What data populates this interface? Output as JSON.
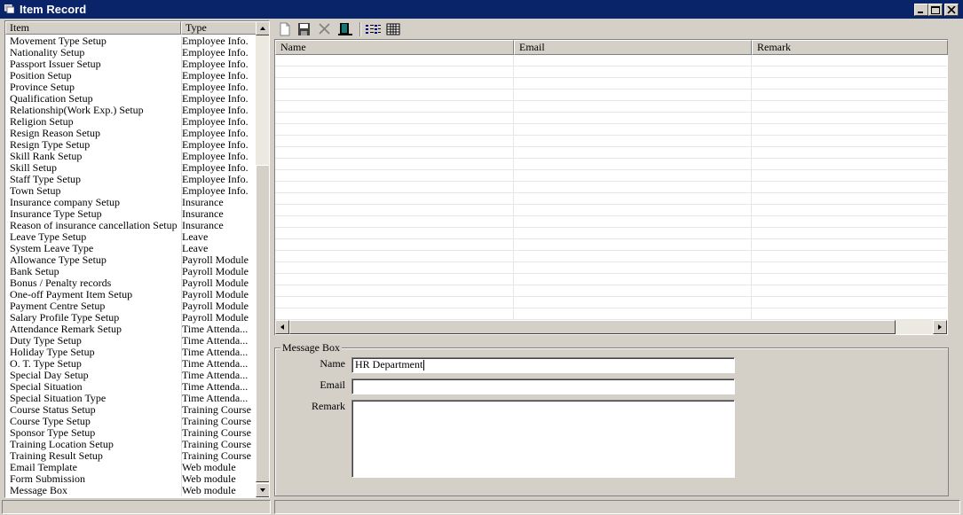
{
  "window": {
    "title": "Item Record"
  },
  "item_list": {
    "headers": {
      "item": "Item",
      "type": "Type"
    },
    "rows": [
      {
        "item": "Movement Type Setup",
        "type": "Employee Info."
      },
      {
        "item": "Nationality Setup",
        "type": "Employee Info."
      },
      {
        "item": "Passport Issuer Setup",
        "type": "Employee Info."
      },
      {
        "item": "Position Setup",
        "type": "Employee Info."
      },
      {
        "item": "Province Setup",
        "type": "Employee Info."
      },
      {
        "item": "Qualification Setup",
        "type": "Employee Info."
      },
      {
        "item": "Relationship(Work Exp.) Setup",
        "type": "Employee Info."
      },
      {
        "item": "Religion Setup",
        "type": "Employee Info."
      },
      {
        "item": "Resign Reason Setup",
        "type": "Employee Info."
      },
      {
        "item": "Resign Type Setup",
        "type": "Employee Info."
      },
      {
        "item": "Skill Rank Setup",
        "type": "Employee Info."
      },
      {
        "item": "Skill Setup",
        "type": "Employee Info."
      },
      {
        "item": "Staff Type Setup",
        "type": "Employee Info."
      },
      {
        "item": "Town Setup",
        "type": "Employee Info."
      },
      {
        "item": "Insurance company Setup",
        "type": "Insurance"
      },
      {
        "item": "Insurance Type Setup",
        "type": "Insurance"
      },
      {
        "item": "Reason of insurance cancellation Setup",
        "type": "Insurance"
      },
      {
        "item": "Leave Type Setup",
        "type": "Leave"
      },
      {
        "item": "System Leave Type",
        "type": "Leave"
      },
      {
        "item": "Allowance Type Setup",
        "type": "Payroll Module"
      },
      {
        "item": "Bank Setup",
        "type": "Payroll Module"
      },
      {
        "item": "Bonus / Penalty records",
        "type": "Payroll Module"
      },
      {
        "item": "One-off Payment Item Setup",
        "type": "Payroll Module"
      },
      {
        "item": "Payment Centre Setup",
        "type": "Payroll Module"
      },
      {
        "item": "Salary Profile Type Setup",
        "type": "Payroll Module"
      },
      {
        "item": "Attendance Remark Setup",
        "type": "Time Attenda..."
      },
      {
        "item": "Duty Type Setup",
        "type": "Time Attenda..."
      },
      {
        "item": "Holiday Type Setup",
        "type": "Time Attenda..."
      },
      {
        "item": "O. T. Type Setup",
        "type": "Time Attenda..."
      },
      {
        "item": "Special Day Setup",
        "type": "Time Attenda..."
      },
      {
        "item": "Special Situation",
        "type": "Time Attenda..."
      },
      {
        "item": "Special Situation Type",
        "type": "Time Attenda..."
      },
      {
        "item": "Course Status Setup",
        "type": "Training Course"
      },
      {
        "item": "Course Type Setup",
        "type": "Training Course"
      },
      {
        "item": "Sponsor Type Setup",
        "type": "Training Course"
      },
      {
        "item": "Training Location Setup",
        "type": "Training Course"
      },
      {
        "item": "Training Result Setup",
        "type": "Training Course"
      },
      {
        "item": "Email Template",
        "type": "Web module"
      },
      {
        "item": "Form Submission",
        "type": "Web module"
      },
      {
        "item": "Message Box",
        "type": "Web module"
      }
    ]
  },
  "toolbar": {
    "buttons": [
      "new-icon",
      "save-icon",
      "delete-icon",
      "exit-icon",
      "list-view-icon",
      "grid-view-icon"
    ]
  },
  "record_grid": {
    "headers": {
      "name": "Name",
      "email": "Email",
      "remark": "Remark"
    }
  },
  "message_box": {
    "legend": "Message Box",
    "name_label": "Name",
    "name_value": "HR Department",
    "email_label": "Email",
    "email_value": "",
    "remark_label": "Remark",
    "remark_value": ""
  },
  "colors": {
    "titlebar": "#0a246a",
    "face": "#d4d0c8"
  }
}
